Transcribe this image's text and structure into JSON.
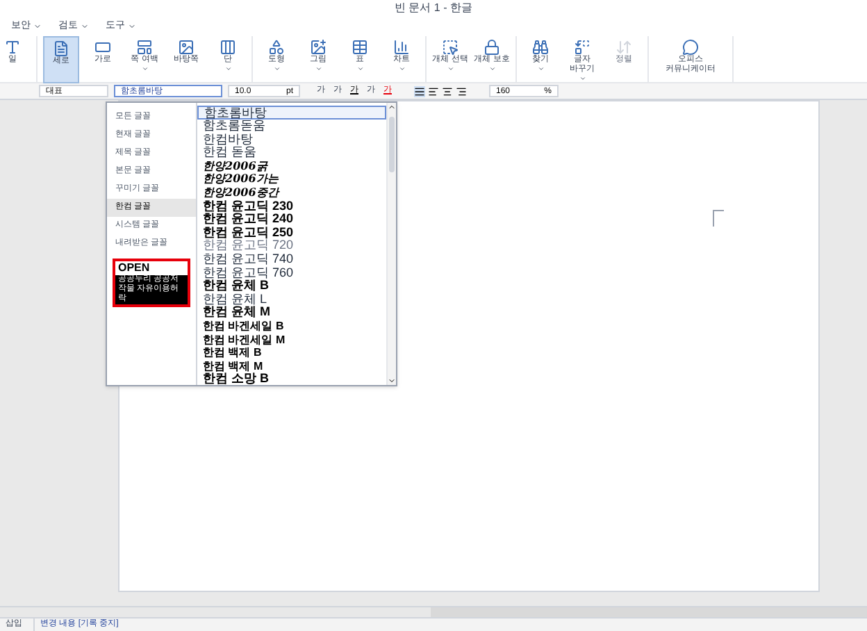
{
  "window": {
    "title": "빈 문서 1 - 한글"
  },
  "menu": [
    "보안",
    "검토",
    "도구"
  ],
  "ribbon": {
    "groups": [
      {
        "buttons": [
          {
            "label": "일",
            "selected": false,
            "disabled": false,
            "menu": false
          }
        ]
      },
      {
        "buttons": [
          {
            "label": "세로",
            "selected": true,
            "disabled": false,
            "menu": false
          },
          {
            "label": "가로",
            "selected": false,
            "disabled": false,
            "menu": false
          },
          {
            "label": "쪽 여백",
            "selected": false,
            "disabled": false,
            "menu": true
          },
          {
            "label": "바탕쪽",
            "selected": false,
            "disabled": false,
            "menu": false
          },
          {
            "label": "단",
            "selected": false,
            "disabled": false,
            "menu": true
          }
        ]
      },
      {
        "buttons": [
          {
            "label": "도형",
            "selected": false,
            "disabled": false,
            "menu": true
          },
          {
            "label": "그림",
            "selected": false,
            "disabled": false,
            "menu": true
          },
          {
            "label": "표",
            "selected": false,
            "disabled": false,
            "menu": true
          },
          {
            "label": "차트",
            "selected": false,
            "disabled": false,
            "menu": true
          }
        ]
      },
      {
        "buttons": [
          {
            "label": "개체 선택",
            "selected": false,
            "disabled": false,
            "menu": true
          },
          {
            "label": "개체 보호",
            "selected": false,
            "disabled": false,
            "menu": true
          }
        ]
      },
      {
        "buttons": [
          {
            "label": "찾기",
            "selected": false,
            "disabled": false,
            "menu": true
          },
          {
            "label": "글자 바꾸기",
            "selected": false,
            "disabled": false,
            "menu": true
          },
          {
            "label": "정렬",
            "selected": false,
            "disabled": true,
            "menu": false
          }
        ]
      },
      {
        "buttons": [
          {
            "label": "오피스 커뮤니케이터",
            "selected": false,
            "disabled": false,
            "menu": false
          }
        ]
      }
    ]
  },
  "format_bar": {
    "style": "대표",
    "font": "함초롬바탕",
    "size": "10.0",
    "unit": "pt",
    "char_buttons": [
      "가",
      "가",
      "가",
      "가",
      "가"
    ],
    "zoom": "160",
    "zoom_unit": "%"
  },
  "font_dropdown": {
    "categories": [
      {
        "label": "모든 글꼴",
        "selected": false
      },
      {
        "label": "현재 글꼴",
        "selected": false
      },
      {
        "label": "제목 글꼴",
        "selected": false
      },
      {
        "label": "본문 글꼴",
        "selected": false
      },
      {
        "label": "꾸미기 글꼴",
        "selected": false
      },
      {
        "label": "한컴 글꼴",
        "selected": true
      },
      {
        "label": "시스템 글꼴",
        "selected": false
      },
      {
        "label": "내려받은 글꼴",
        "selected": false
      }
    ],
    "badge": {
      "title": "OPEN",
      "caption": "공공누리 공공저작물 자유이용허락"
    },
    "fonts": [
      {
        "label": "함초롬바탕",
        "kind": "regular",
        "selected": true
      },
      {
        "label": "함초롬돋움",
        "kind": "regular",
        "selected": false
      },
      {
        "label": "한컴바탕",
        "kind": "regular",
        "selected": false
      },
      {
        "label": "한컴 돋움",
        "kind": "regular",
        "selected": false
      },
      {
        "label": "한양2006굵",
        "kind": "script",
        "selected": false
      },
      {
        "label": "한양2006가는",
        "kind": "script",
        "selected": false
      },
      {
        "label": "한양2006중간",
        "kind": "script",
        "selected": false
      },
      {
        "label": "한컴 윤고딕 230",
        "kind": "bold",
        "selected": false
      },
      {
        "label": "한컴 윤고딕 240",
        "kind": "bold",
        "selected": false
      },
      {
        "label": "한컴 윤고딕 250",
        "kind": "bold",
        "selected": false
      },
      {
        "label": "한컴 윤고딕 720",
        "kind": "light",
        "selected": false
      },
      {
        "label": "한컴 윤고딕 740",
        "kind": "regular",
        "selected": false
      },
      {
        "label": "한컴 윤고딕 760",
        "kind": "regular",
        "selected": false
      },
      {
        "label": "한컴 윤체 B",
        "kind": "bold",
        "selected": false
      },
      {
        "label": "한컴 윤체 L",
        "kind": "regular",
        "selected": false
      },
      {
        "label": "한컴 윤체 M",
        "kind": "bold",
        "selected": false
      },
      {
        "label": "한컴 바겐세일 B",
        "kind": "small",
        "selected": false
      },
      {
        "label": "한컴 바겐세일 M",
        "kind": "small",
        "selected": false
      },
      {
        "label": "한컴 백제 B",
        "kind": "small",
        "selected": false
      },
      {
        "label": "한컴 백제 M",
        "kind": "small",
        "selected": false
      },
      {
        "label": "한컴 소망 B",
        "kind": "bold",
        "selected": false
      }
    ]
  },
  "status_bar": {
    "mode": "삽입",
    "track_changes": "변경 내용 [기록 중지]"
  }
}
